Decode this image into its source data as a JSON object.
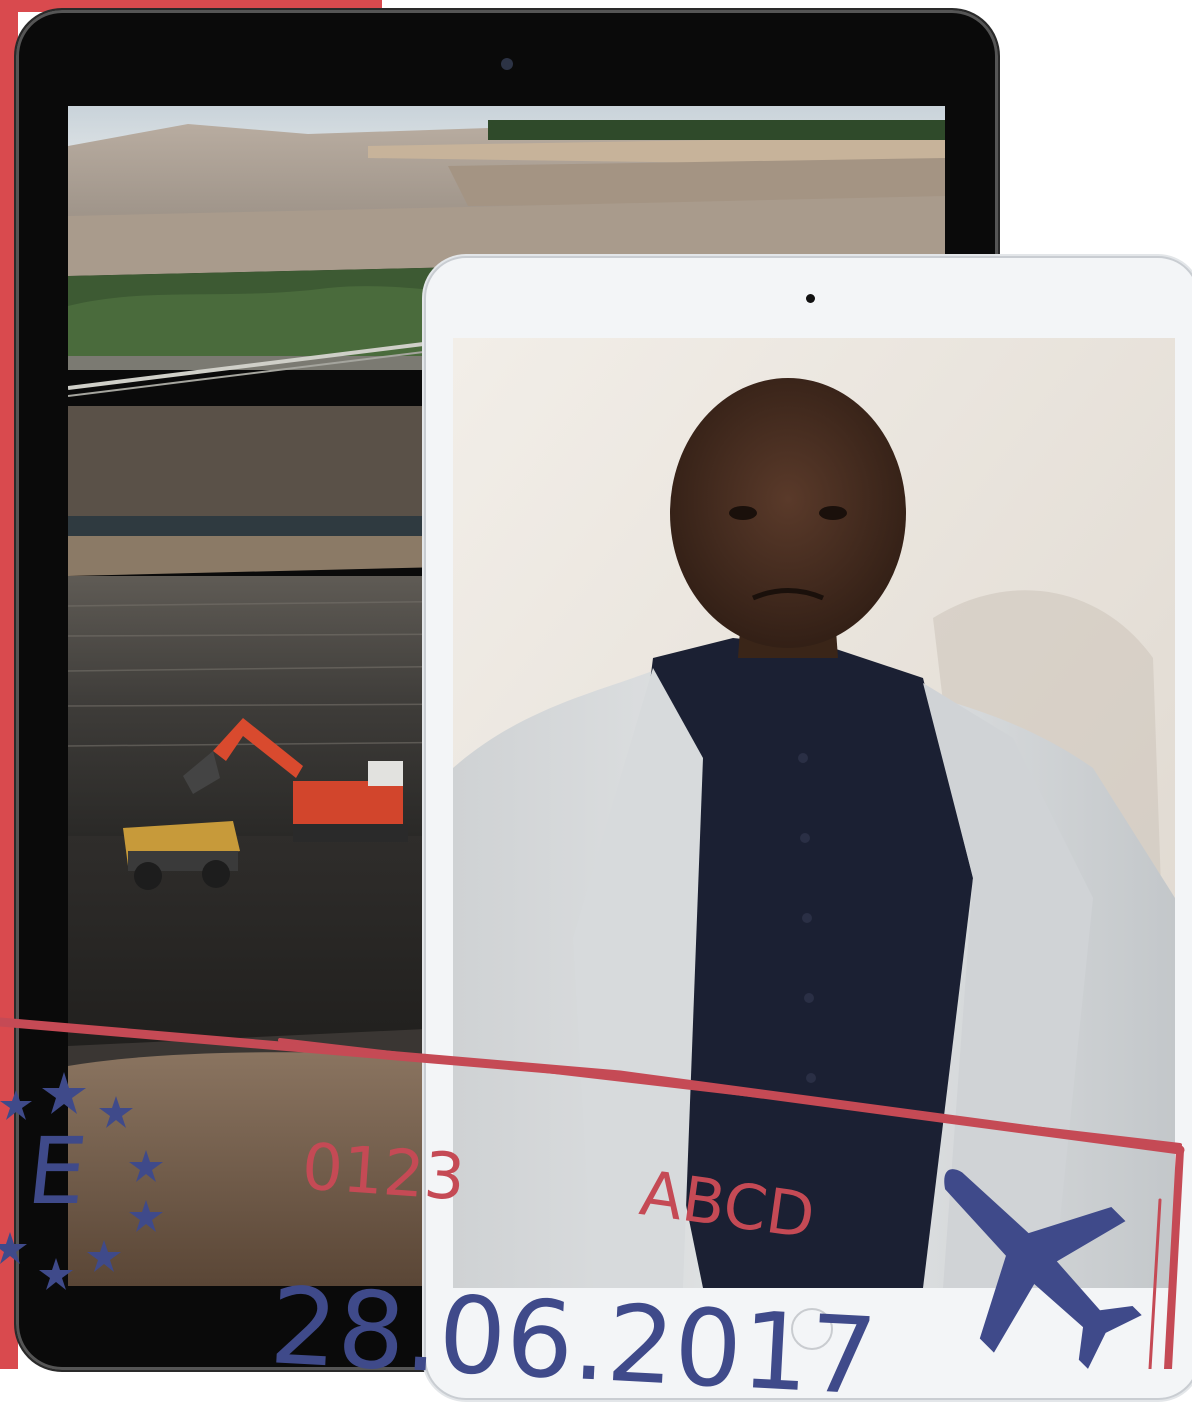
{
  "stamp": {
    "letter": "E",
    "number": "0123",
    "code": "ABCD",
    "date": "28.06.2017"
  },
  "colors": {
    "accent_red": "#d94a4e",
    "stamp_red": "#c54a55",
    "stamp_blue": "#3f4a8a"
  },
  "icons": {
    "airplane": "airplane-icon",
    "stars": "star-icon"
  }
}
